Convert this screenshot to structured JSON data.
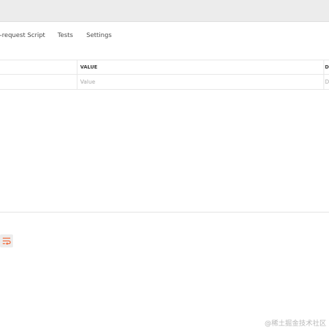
{
  "tabs": {
    "pre_request_script": "e-request Script",
    "tests": "Tests",
    "settings": "Settings"
  },
  "table": {
    "headers": [
      "",
      "VALUE",
      "D"
    ],
    "row": [
      "",
      "Value",
      "D"
    ]
  },
  "icons": {
    "wrap": "text-wrap-icon"
  },
  "colors": {
    "accent": "#f26b3a",
    "header_strip": "#ececec",
    "border": "#e6e6e6",
    "placeholder": "#a8a8a8"
  },
  "watermark": "@稀土掘金技术社区"
}
